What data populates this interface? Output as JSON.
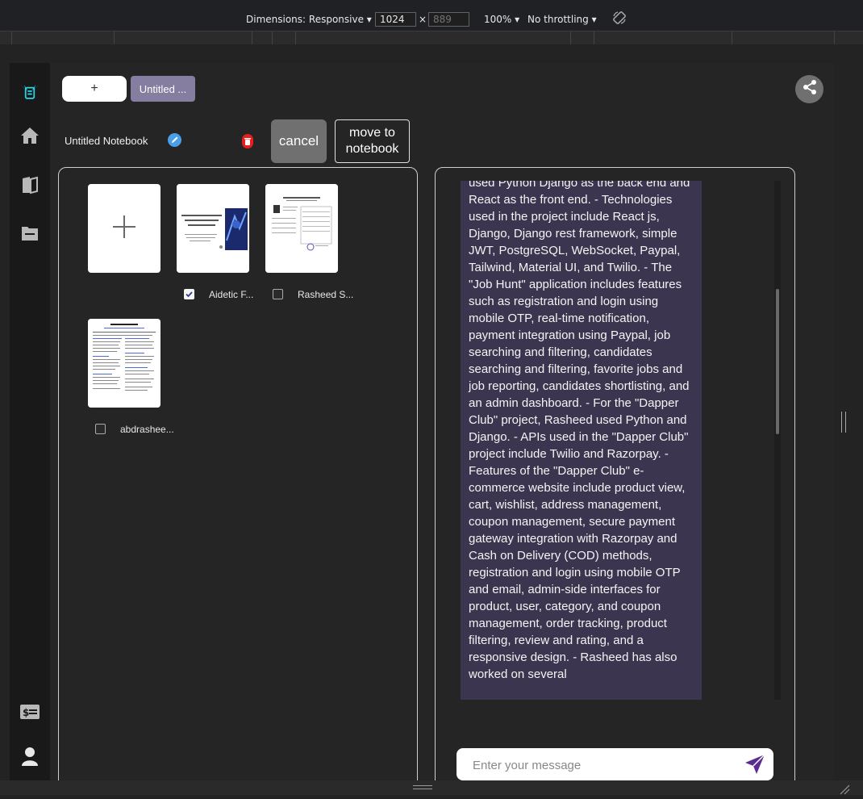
{
  "devtools": {
    "dimensions_label": "Dimensions: Responsive",
    "width_value": "1024",
    "times": "×",
    "height_placeholder": "889",
    "zoom": "100%",
    "throttling": "No throttling"
  },
  "tabs": {
    "add_label": "+",
    "notebook_tab": "Untitled ..."
  },
  "toolbar": {
    "notebook_title": "Untitled Notebook",
    "cancel_label": "cancel",
    "move_label": "move to notebook"
  },
  "documents": [
    {
      "label": "Aidetic F...",
      "checked": true
    },
    {
      "label": "Rasheed S...",
      "checked": false
    },
    {
      "label": "abdrashee...",
      "checked": false
    }
  ],
  "chat": {
    "message": "used Python Django as the back end and React as the front end. - Technologies used in the project include React js, Django, Django rest framework, simple JWT, PostgreSQL, WebSocket, Paypal, Tailwind, Material UI, and Twilio. - The \"Job Hunt\" application includes features such as registration and login using mobile OTP, real-time notification, payment integration using Paypal, job searching and filtering, candidates searching and filtering, favorite jobs and job reporting, candidates shortlisting, and an admin dashboard. - For the \"Dapper Club\" project, Rasheed used Python and Django. - APIs used in the \"Dapper Club\" project include Twilio and Razorpay. - Features of the \"Dapper Club\" e-commerce website include product view, cart, wishlist, address management, coupon management, secure payment gateway integration with Razorpay and Cash on Delivery (COD) methods, registration and login using mobile OTP and email, admin-side interfaces for product, user, category, and coupon management, order tracking, product filtering, review and rating, and a responsive design. - Rasheed has also worked on several",
    "input_placeholder": "Enter your message"
  },
  "colors": {
    "accent_cyan": "#29d5e6",
    "tab_active": "#857ea1",
    "message_bg": "#3b3550",
    "send_icon": "#5b2d8e",
    "delete_red": "#e61e1e",
    "edit_blue": "#4a9fe8"
  },
  "icons": {
    "logo": "winged-robot-icon",
    "nav": [
      "home-icon",
      "book-icon",
      "folder-icon"
    ],
    "bottom": [
      "billing-icon",
      "user-icon"
    ],
    "share": "share-icon",
    "edit": "pencil-icon",
    "delete": "trash-icon",
    "send": "send-icon"
  }
}
